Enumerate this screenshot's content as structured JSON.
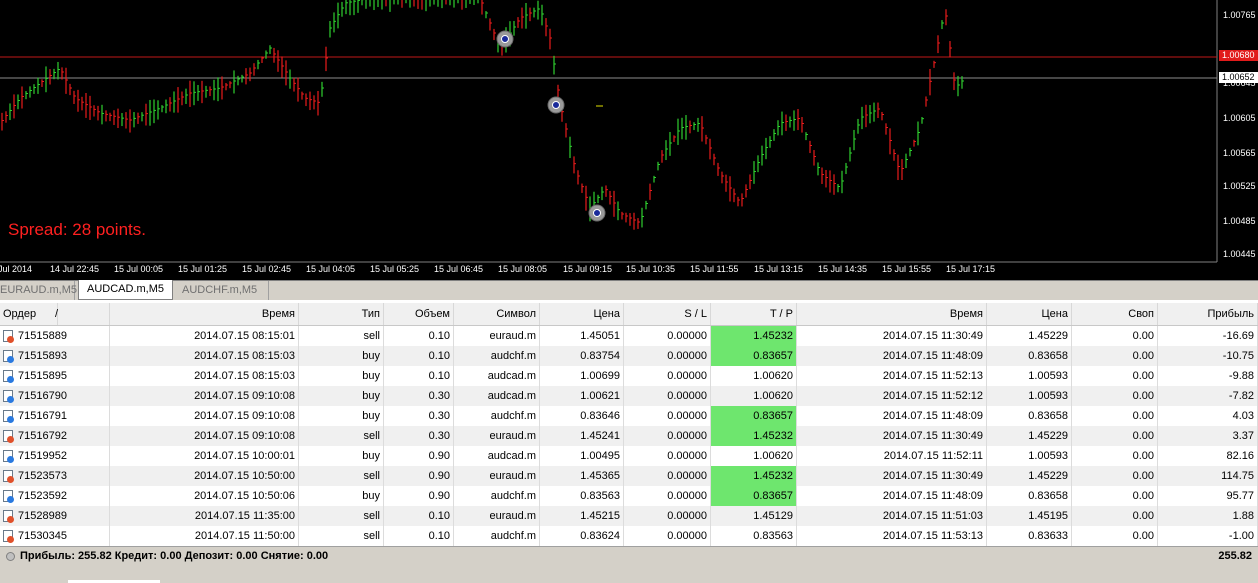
{
  "chart": {
    "spread_label": "Spread: 28 points.",
    "price_ticks": [
      "1.00765",
      "1.00645",
      "1.00605",
      "1.00565",
      "1.00525",
      "1.00485",
      "1.00445"
    ],
    "time_ticks": [
      "Jul 2014",
      "14 Jul 22:45",
      "15 Jul 00:05",
      "15 Jul 01:25",
      "15 Jul 02:45",
      "15 Jul 04:05",
      "15 Jul 05:25",
      "15 Jul 06:45",
      "15 Jul 08:05",
      "15 Jul 09:15",
      "15 Jul 10:35",
      "15 Jul 11:55",
      "15 Jul 13:15",
      "15 Jul 14:35",
      "15 Jul 15:55",
      "15 Jul 17:15"
    ],
    "ask_tag": "1.00680",
    "bid_tag": "1.00652",
    "colors": {
      "up": "#2fd02f",
      "down": "#e81c1c",
      "ask_line": "#c01818",
      "bid_line": "#8c8c8c"
    }
  },
  "tabs": [
    {
      "label": "EURAUD.m,M5",
      "active": false
    },
    {
      "label": "AUDCAD.m,M5",
      "active": true
    },
    {
      "label": "AUDCHF.m,M5",
      "active": false
    }
  ],
  "table": {
    "headers": [
      "Ордер",
      "/",
      "Время",
      "Тип",
      "Объем",
      "Символ",
      "Цена",
      "S / L",
      "T / P",
      "Время",
      "Цена",
      "Своп",
      "Прибыль"
    ],
    "rows": [
      {
        "order": "71515889",
        "open_time": "2014.07.15 08:15:01",
        "type": "sell",
        "volume": "0.10",
        "symbol": "euraud.m",
        "open_price": "1.45051",
        "sl": "0.00000",
        "tp": "1.45232",
        "tp_hit": true,
        "close_time": "2014.07.15 11:30:49",
        "close_price": "1.45229",
        "swap": "0.00",
        "profit": "-16.69"
      },
      {
        "order": "71515893",
        "open_time": "2014.07.15 08:15:03",
        "type": "buy",
        "volume": "0.10",
        "symbol": "audchf.m",
        "open_price": "0.83754",
        "sl": "0.00000",
        "tp": "0.83657",
        "tp_hit": true,
        "close_time": "2014.07.15 11:48:09",
        "close_price": "0.83658",
        "swap": "0.00",
        "profit": "-10.75"
      },
      {
        "order": "71515895",
        "open_time": "2014.07.15 08:15:03",
        "type": "buy",
        "volume": "0.10",
        "symbol": "audcad.m",
        "open_price": "1.00699",
        "sl": "0.00000",
        "tp": "1.00620",
        "tp_hit": false,
        "close_time": "2014.07.15 11:52:13",
        "close_price": "1.00593",
        "swap": "0.00",
        "profit": "-9.88"
      },
      {
        "order": "71516790",
        "open_time": "2014.07.15 09:10:08",
        "type": "buy",
        "volume": "0.30",
        "symbol": "audcad.m",
        "open_price": "1.00621",
        "sl": "0.00000",
        "tp": "1.00620",
        "tp_hit": false,
        "close_time": "2014.07.15 11:52:12",
        "close_price": "1.00593",
        "swap": "0.00",
        "profit": "-7.82"
      },
      {
        "order": "71516791",
        "open_time": "2014.07.15 09:10:08",
        "type": "buy",
        "volume": "0.30",
        "symbol": "audchf.m",
        "open_price": "0.83646",
        "sl": "0.00000",
        "tp": "0.83657",
        "tp_hit": true,
        "close_time": "2014.07.15 11:48:09",
        "close_price": "0.83658",
        "swap": "0.00",
        "profit": "4.03"
      },
      {
        "order": "71516792",
        "open_time": "2014.07.15 09:10:08",
        "type": "sell",
        "volume": "0.30",
        "symbol": "euraud.m",
        "open_price": "1.45241",
        "sl": "0.00000",
        "tp": "1.45232",
        "tp_hit": true,
        "close_time": "2014.07.15 11:30:49",
        "close_price": "1.45229",
        "swap": "0.00",
        "profit": "3.37"
      },
      {
        "order": "71519952",
        "open_time": "2014.07.15 10:00:01",
        "type": "buy",
        "volume": "0.90",
        "symbol": "audcad.m",
        "open_price": "1.00495",
        "sl": "0.00000",
        "tp": "1.00620",
        "tp_hit": false,
        "close_time": "2014.07.15 11:52:11",
        "close_price": "1.00593",
        "swap": "0.00",
        "profit": "82.16"
      },
      {
        "order": "71523573",
        "open_time": "2014.07.15 10:50:00",
        "type": "sell",
        "volume": "0.90",
        "symbol": "euraud.m",
        "open_price": "1.45365",
        "sl": "0.00000",
        "tp": "1.45232",
        "tp_hit": true,
        "close_time": "2014.07.15 11:30:49",
        "close_price": "1.45229",
        "swap": "0.00",
        "profit": "114.75"
      },
      {
        "order": "71523592",
        "open_time": "2014.07.15 10:50:06",
        "type": "buy",
        "volume": "0.90",
        "symbol": "audchf.m",
        "open_price": "0.83563",
        "sl": "0.00000",
        "tp": "0.83657",
        "tp_hit": true,
        "close_time": "2014.07.15 11:48:09",
        "close_price": "0.83658",
        "swap": "0.00",
        "profit": "95.77"
      },
      {
        "order": "71528989",
        "open_time": "2014.07.15 11:35:00",
        "type": "sell",
        "volume": "0.10",
        "symbol": "euraud.m",
        "open_price": "1.45215",
        "sl": "0.00000",
        "tp": "1.45129",
        "tp_hit": false,
        "close_time": "2014.07.15 11:51:03",
        "close_price": "1.45195",
        "swap": "0.00",
        "profit": "1.88"
      },
      {
        "order": "71530345",
        "open_time": "2014.07.15 11:50:00",
        "type": "sell",
        "volume": "0.10",
        "symbol": "audchf.m",
        "open_price": "0.83624",
        "sl": "0.00000",
        "tp": "0.83563",
        "tp_hit": false,
        "close_time": "2014.07.15 11:53:13",
        "close_price": "0.83633",
        "swap": "0.00",
        "profit": "-1.00"
      }
    ]
  },
  "status": {
    "summary": "Прибыль: 255.82  Кредит: 0.00  Депозит: 0.00  Снятие: 0.00",
    "total": "255.82"
  }
}
